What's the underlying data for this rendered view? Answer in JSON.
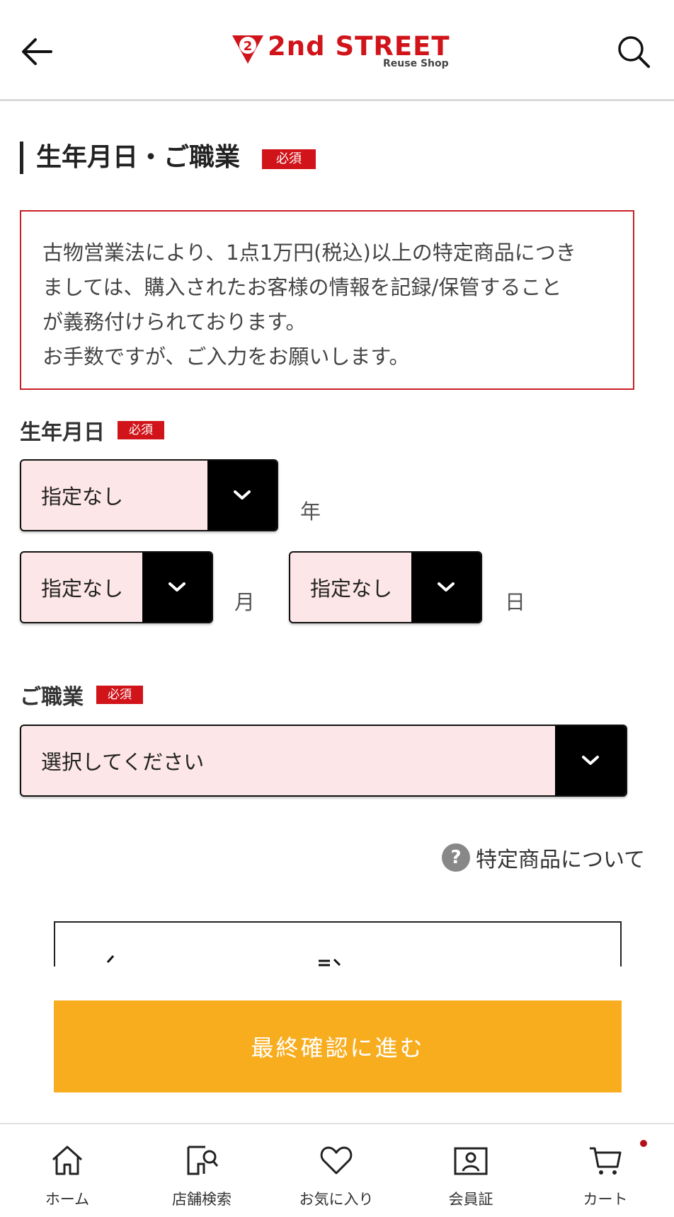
{
  "header": {
    "logo_text": "2nd STREET",
    "logo_sub": "Reuse Shop",
    "logo_badge": "2",
    "back_icon": "arrow-left-icon",
    "search_icon": "search-icon"
  },
  "section": {
    "title": "生年月日・ご職業",
    "required": "必須"
  },
  "notice": {
    "lines": [
      "古物営業法により、1点1万円(税込)以上の特定商品につき",
      "ましては、購入されたお客様の情報を記録/保管すること",
      "が義務付けられております。",
      "お手数ですが、ご入力をお願いします。"
    ]
  },
  "birthday": {
    "label": "生年月日",
    "required": "必須",
    "year": {
      "value": "指定なし",
      "unit": "年"
    },
    "month": {
      "value": "指定なし",
      "unit": "月"
    },
    "day": {
      "value": "指定なし",
      "unit": "日"
    }
  },
  "occupation": {
    "label": "ご職業",
    "required": "必須",
    "value": "選択してください"
  },
  "help": {
    "icon_text": "?",
    "label": "特定商品について"
  },
  "cta": {
    "label": "最終確認に進む"
  },
  "bottom_nav": {
    "items": [
      {
        "label": "ホーム",
        "icon": "home-icon"
      },
      {
        "label": "店舗検索",
        "icon": "store-search-icon"
      },
      {
        "label": "お気に入り",
        "icon": "heart-icon"
      },
      {
        "label": "会員証",
        "icon": "member-card-icon"
      },
      {
        "label": "カート",
        "icon": "cart-icon"
      }
    ]
  },
  "colors": {
    "brand_red": "#d0141a",
    "cta_orange": "#f8ad1f",
    "select_bg": "#fde6e7"
  }
}
